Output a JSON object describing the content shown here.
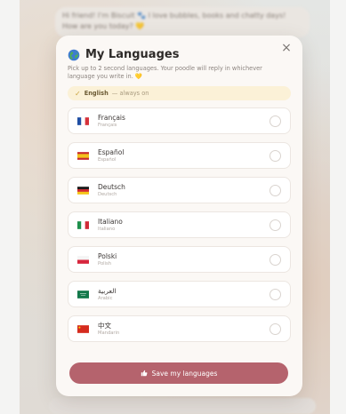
{
  "background": {
    "chat_text": "Hi friend! I'm Biscuit 🐾 I love bubbles, books and chatty days! How are you today? 💛"
  },
  "modal": {
    "title": "My Languages",
    "subtitle": "Pick up to 2 second languages. Your poodle will reply in whichever language you write in.",
    "heart": "💛",
    "close_label": "×",
    "always_on": {
      "check": "✓",
      "language": "English",
      "note": "— always on"
    },
    "languages": [
      {
        "native": "Français",
        "english": "Français",
        "flag": "fr-flag-icon"
      },
      {
        "native": "Español",
        "english": "Español",
        "flag": "es-flag-icon"
      },
      {
        "native": "Deutsch",
        "english": "Deutsch",
        "flag": "de-flag-icon"
      },
      {
        "native": "Italiano",
        "english": "Italiano",
        "flag": "it-flag-icon"
      },
      {
        "native": "Polski",
        "english": "Polish",
        "flag": "pl-flag-icon"
      },
      {
        "native": "العربية",
        "english": "Arabic",
        "flag": "sa-flag-icon"
      },
      {
        "native": "中文",
        "english": "Mandarin",
        "flag": "cn-flag-icon"
      }
    ],
    "save_label": "Save my languages",
    "colors": {
      "accent": "#b5636d",
      "always_on_bg": "#fbf1d7",
      "modal_bg": "#fbf8f5"
    }
  }
}
